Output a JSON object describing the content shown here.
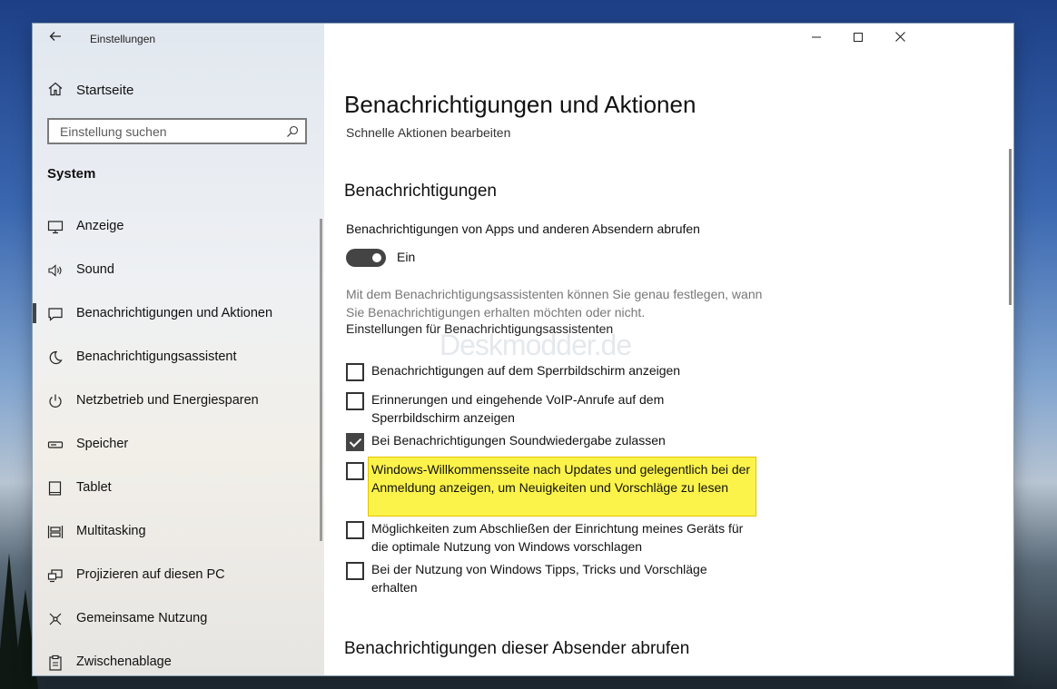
{
  "window": {
    "title": "Einstellungen",
    "caption_icons": [
      "minimize-icon",
      "maximize-icon",
      "close-icon"
    ]
  },
  "sidebar": {
    "home_label": "Startseite",
    "search_placeholder": "Einstellung suchen",
    "section": "System",
    "items": [
      {
        "label": "Anzeige",
        "icon": "display-icon"
      },
      {
        "label": "Sound",
        "icon": "speaker-icon"
      },
      {
        "label": "Benachrichtigungen und Aktionen",
        "icon": "notification-icon",
        "active": true
      },
      {
        "label": "Benachrichtigungsassistent",
        "icon": "moon-icon"
      },
      {
        "label": "Netzbetrieb und Energiesparen",
        "icon": "power-icon"
      },
      {
        "label": "Speicher",
        "icon": "storage-icon"
      },
      {
        "label": "Tablet",
        "icon": "tablet-icon"
      },
      {
        "label": "Multitasking",
        "icon": "multitasking-icon"
      },
      {
        "label": "Projizieren auf diesen PC",
        "icon": "project-icon"
      },
      {
        "label": "Gemeinsame Nutzung",
        "icon": "share-icon"
      },
      {
        "label": "Zwischenablage",
        "icon": "clipboard-icon"
      }
    ]
  },
  "main": {
    "title": "Benachrichtigungen und Aktionen",
    "quick_actions_link": "Schnelle Aktionen bearbeiten",
    "notifications_heading": "Benachrichtigungen",
    "toggle_label": "Benachrichtigungen von Apps und anderen Absendern abrufen",
    "toggle_state": "Ein",
    "description": "Mit dem Benachrichtigungsassistenten können Sie genau festlegen, wann Sie Benachrichtigungen erhalten möchten oder nicht.",
    "assistant_link": "Einstellungen für Benachrichtigungsassistenten",
    "watermark": "Deskmodder.de",
    "checkboxes": [
      {
        "label": "Benachrichtigungen auf dem Sperrbildschirm anzeigen",
        "checked": false
      },
      {
        "label": "Erinnerungen und eingehende VoIP-Anrufe auf dem Sperrbildschirm anzeigen",
        "checked": false
      },
      {
        "label": "Bei Benachrichtigungen Soundwiedergabe zulassen",
        "checked": true
      },
      {
        "label": "Windows-Willkommensseite nach Updates und gelegentlich bei der Anmeldung anzeigen, um Neuigkeiten und Vorschläge zu lesen",
        "checked": false,
        "highlighted": true
      },
      {
        "label": "Möglichkeiten zum Abschließen der Einrichtung meines Geräts für die optimale Nutzung von Windows vorschlagen",
        "checked": false
      },
      {
        "label": "Bei der Nutzung von Windows Tipps, Tricks und Vorschläge erhalten",
        "checked": false
      }
    ],
    "senders_heading": "Benachrichtigungen dieser Absender abrufen"
  },
  "colors": {
    "highlight": "#fbf34a",
    "toggle_on": "#444444",
    "accent_text": "#111111"
  }
}
